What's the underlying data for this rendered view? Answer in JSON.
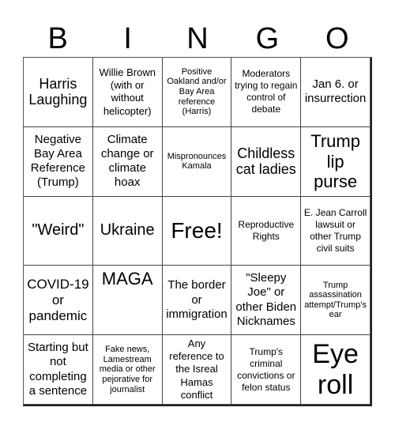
{
  "header": {
    "letters": [
      "B",
      "I",
      "N",
      "G",
      "O"
    ]
  },
  "card": {
    "rows": [
      [
        "Harris Laughing",
        "Willie Brown (with or without helicopter)",
        "Positive Oakland and/or Bay Area reference (Harris)",
        "Moderators trying to regain control of debate",
        "Jan 6. or insurrection"
      ],
      [
        "Negative Bay Area Reference (Trump)",
        "Climate change or climate hoax",
        "Mispronounces Kamala",
        "Childless cat ladies",
        "Trump lip purse"
      ],
      [
        "\"Weird\"",
        "Ukraine",
        "Free!",
        "Reproductive Rights",
        "E. Jean Carroll lawsuit or other Trump civil suits"
      ],
      [
        "COVID-19 or pandemic",
        "MAGA",
        "The border or immigration",
        "\"Sleepy Joe\" or other Biden Nicknames",
        "Trump assassination attempt/Trump's ear"
      ],
      [
        "Starting but not completing a sentence",
        "Fake news, Lamestream media or other pejorative for journalist",
        "Any reference to the Isreal Hamas conflict",
        "Trump's criminal convictions or felon status",
        "Eye roll"
      ]
    ],
    "free_space": {
      "row": 2,
      "col": 2
    }
  }
}
